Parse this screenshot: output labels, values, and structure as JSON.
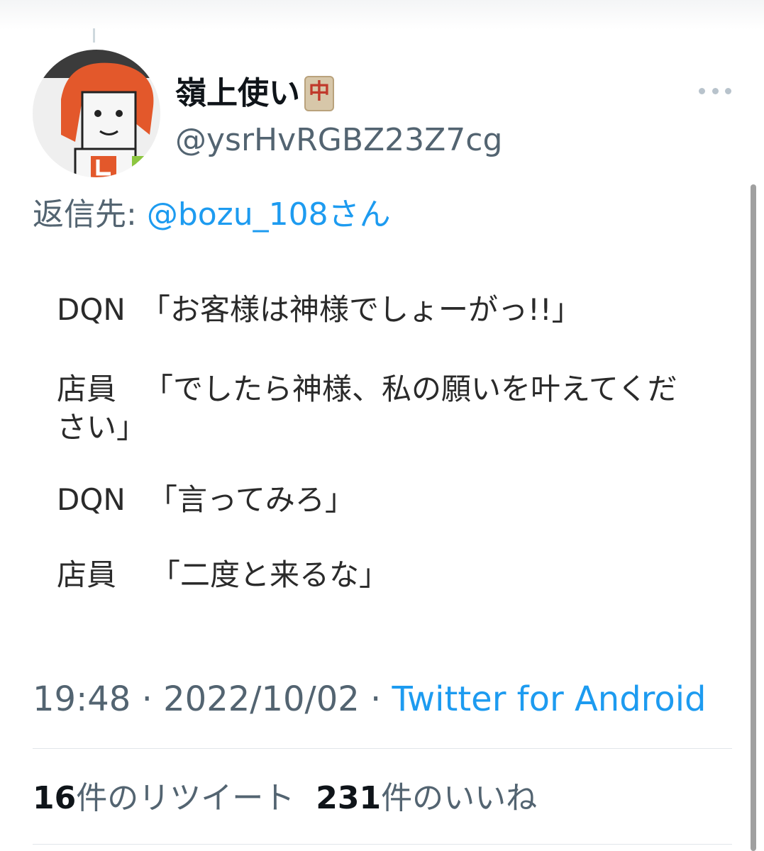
{
  "tweet": {
    "display_name": "嶺上使い",
    "name_emoji": "🀄",
    "emoji_glyph": "中",
    "handle": "@ysrHvRGBZ23Z7cg",
    "reply_label": "返信先: ",
    "reply_to": "@bozu_108さん",
    "image_text": {
      "line1_speaker": "DQN",
      "line1_text": "「お客様は神様でしょーがっ!!」",
      "line2_speaker": "店員",
      "line2_text": "「でしたら神様、私の願いを叶えてくだ",
      "line2_cont": "さい」",
      "line3_speaker": "DQN",
      "line3_text": "「言ってみろ」",
      "line4_speaker": "店員",
      "line4_text": "「二度と来るな」"
    },
    "time": "19:48",
    "separator": " · ",
    "date": "2022/10/02",
    "source": "Twitter for Android",
    "retweet_count": "16",
    "retweet_label": "件のリツイート",
    "like_count": "231",
    "like_label": "件のいいね"
  },
  "colors": {
    "link": "#1d9bf0",
    "muted": "#536471",
    "text": "#0f1419"
  }
}
